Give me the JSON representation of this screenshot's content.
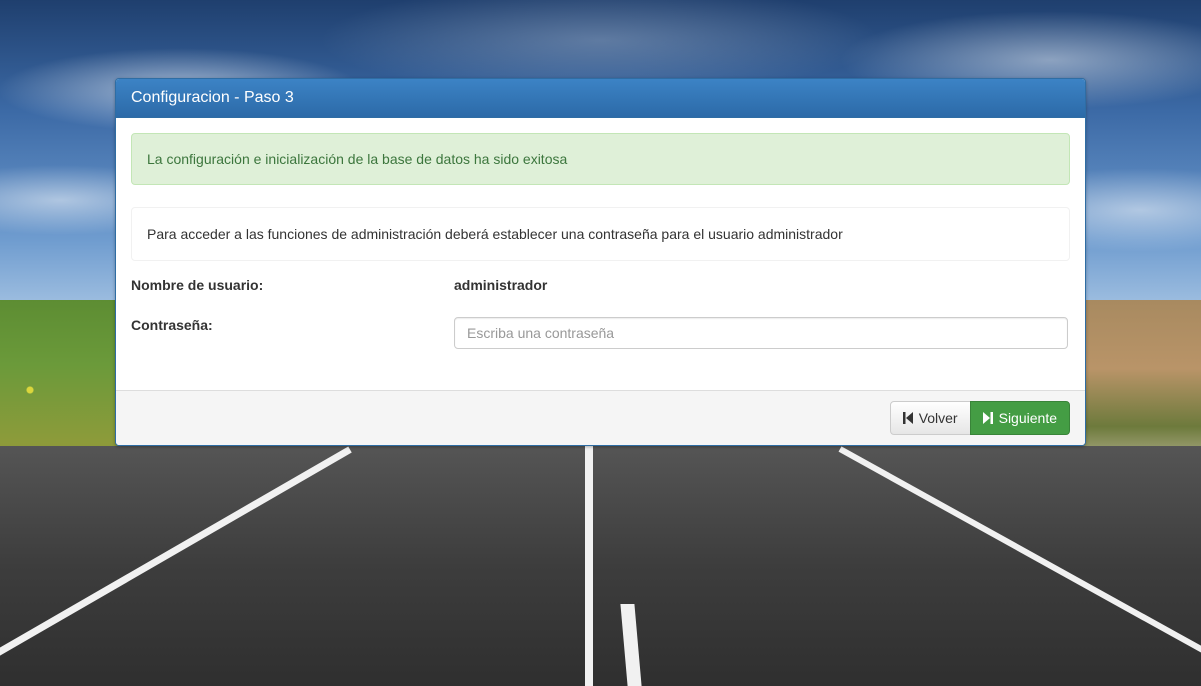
{
  "panel": {
    "title": "Configuracion - Paso 3"
  },
  "alert": {
    "message": "La configuración e inicialización de la base de datos ha sido exitosa"
  },
  "info": {
    "message": "Para acceder a las funciones de administración deberá establecer una contraseña para el usuario administrador"
  },
  "form": {
    "username_label": "Nombre de usuario:",
    "username_value": "administrador",
    "password_label": "Contraseña:",
    "password_value": "",
    "password_placeholder": "Escriba una contraseña"
  },
  "footer": {
    "back_label": "Volver",
    "back_icon": "step-backward-icon",
    "next_label": "Siguiente",
    "next_icon": "step-forward-icon"
  },
  "colors": {
    "primary": "#337ab7",
    "success": "#449d44",
    "alert_bg": "#dff0d8",
    "alert_text": "#3c763d"
  }
}
